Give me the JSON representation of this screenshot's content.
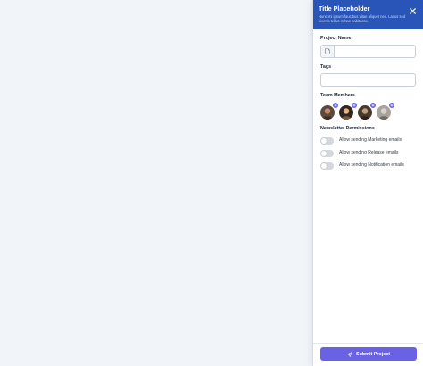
{
  "panel": {
    "title": "Title Placeholder",
    "description": "Nunc mi ipsum faucibus vitae aliquet nec. Lacus sed viverra tellus in hac habitasse.",
    "close_icon": "close-icon"
  },
  "form": {
    "project_name": {
      "label": "Project Name",
      "value": "",
      "placeholder": "",
      "icon": "document-icon"
    },
    "tags": {
      "label": "Tags",
      "value": "",
      "placeholder": ""
    },
    "team_members": {
      "label": "Team Members",
      "members": [
        {
          "avatar_colors": [
            "#3b2a22",
            "#c48a62"
          ]
        },
        {
          "avatar_colors": [
            "#2f2622",
            "#e2b07c"
          ]
        },
        {
          "avatar_colors": [
            "#4a3a2c",
            "#bfa07d"
          ]
        },
        {
          "avatar_colors": [
            "#8e8a86",
            "#c9c4bc"
          ]
        }
      ],
      "badge_icon": "plus-icon",
      "badge_color": "#6b63e8"
    },
    "newsletter": {
      "label": "Newsletter Permissions",
      "options": [
        {
          "label": "Allow sending Marketing emails",
          "enabled": false
        },
        {
          "label": "Allow sending Release emails",
          "enabled": false
        },
        {
          "label": "Allow sending Notification emails",
          "enabled": false
        }
      ]
    }
  },
  "footer": {
    "submit_label": "Submit Project",
    "submit_icon": "send-icon"
  },
  "colors": {
    "header": "#2a55b8",
    "accent": "#6a62e6",
    "backdrop": "#f1f4f9"
  }
}
